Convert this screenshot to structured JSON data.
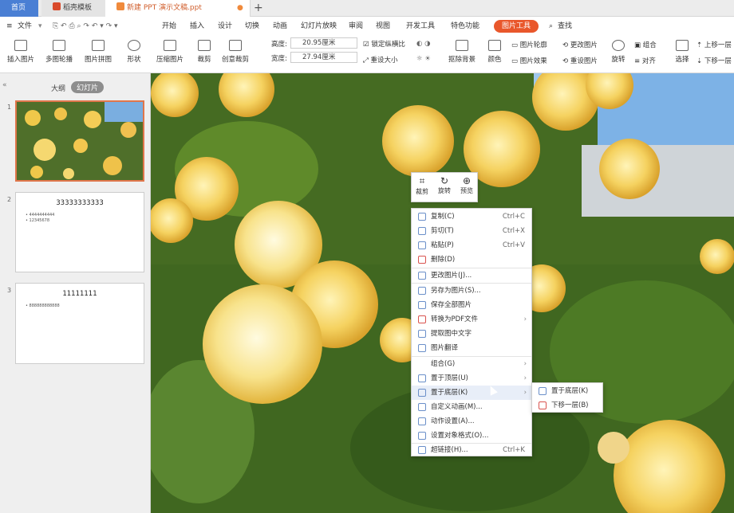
{
  "tabs": {
    "home": "首页",
    "daoke": "稻壳模板",
    "doc": "新建 PPT 演示文稿.ppt",
    "new_tab": "+"
  },
  "menubar": {
    "file": "文件",
    "items": [
      "开始",
      "插入",
      "设计",
      "切换",
      "动画",
      "幻灯片放映",
      "审阅",
      "视图",
      "开发工具",
      "特色功能"
    ],
    "active": "图片工具",
    "search": "查找"
  },
  "toolbar": {
    "insert_picture": "插入图片",
    "multi_outline": "多图轮播",
    "picture_collage": "图片拼图",
    "shape": "形状",
    "compress_picture": "压缩图片",
    "crop": "裁剪",
    "creative_crop": "创意裁剪",
    "height_label": "高度:",
    "height_value": "20.95厘米",
    "width_label": "宽度:",
    "width_value": "27.94厘米",
    "lock_ratio": "锁定纵横比",
    "reset_size": "重设大小",
    "remove_bg": "抠除背景",
    "color": "颜色",
    "picture_outline": "图片轮廓",
    "picture_effect": "图片效果",
    "change_picture": "更改图片",
    "reset_picture": "重设图片",
    "rotate": "旋转",
    "group": "组合",
    "align": "对齐",
    "select": "选择",
    "bring_forward": "上移一层",
    "send_backward": "下移一层"
  },
  "sidebar": {
    "outline_tab": "大纲",
    "slides_tab": "幻灯片",
    "slides": [
      {
        "num": "1",
        "title": "",
        "bullets": []
      },
      {
        "num": "2",
        "title": "33333333333",
        "bullets": [
          "4444444444",
          "12345678"
        ]
      },
      {
        "num": "3",
        "title": "11111111",
        "bullets": [
          "888888888888"
        ]
      }
    ]
  },
  "float_toolbar": {
    "crop": "裁剪",
    "rotate": "旋转",
    "preview": "预览"
  },
  "context_menu": [
    {
      "label": "复制(C)",
      "shortcut": "Ctrl+C",
      "arrow": false
    },
    {
      "label": "剪切(T)",
      "shortcut": "Ctrl+X",
      "arrow": false
    },
    {
      "label": "粘贴(P)",
      "shortcut": "Ctrl+V",
      "arrow": false
    },
    {
      "label": "删除(D)",
      "shortcut": "",
      "arrow": false
    },
    {
      "label": "更改图片(J)...",
      "shortcut": "",
      "arrow": false
    },
    {
      "label": "另存为图片(S)...",
      "shortcut": "",
      "arrow": false
    },
    {
      "label": "保存全部图片",
      "shortcut": "",
      "arrow": false
    },
    {
      "label": "转换为PDF文件",
      "shortcut": "",
      "arrow": true
    },
    {
      "label": "提取图中文字",
      "shortcut": "",
      "arrow": false
    },
    {
      "label": "图片翻译",
      "shortcut": "",
      "arrow": false
    },
    {
      "label": "组合(G)",
      "shortcut": "",
      "arrow": true
    },
    {
      "label": "置于顶层(U)",
      "shortcut": "",
      "arrow": true
    },
    {
      "label": "置于底层(K)",
      "shortcut": "",
      "arrow": true
    },
    {
      "label": "自定义动画(M)...",
      "shortcut": "",
      "arrow": false
    },
    {
      "label": "动作设置(A)...",
      "shortcut": "",
      "arrow": false
    },
    {
      "label": "设置对象格式(O)...",
      "shortcut": "",
      "arrow": false
    },
    {
      "label": "超链接(H)...",
      "shortcut": "Ctrl+K",
      "arrow": false
    }
  ],
  "submenu": [
    "置于底层(K)",
    "下移一层(B)"
  ],
  "colors": {
    "accent": "#e9572b",
    "home_tab": "#4a7fd4",
    "selected_slide_border": "#e0764b",
    "menu_highlight": "#e8eef8"
  }
}
